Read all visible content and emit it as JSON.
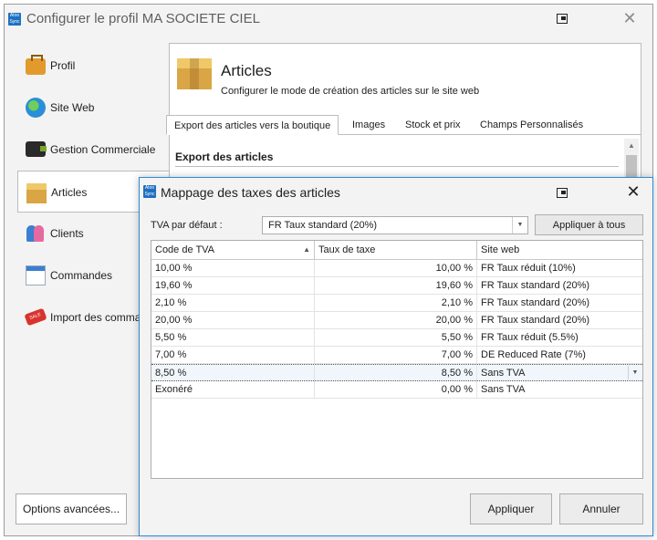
{
  "main_window": {
    "title": "Configurer le profil MA SOCIETE CIEL",
    "app_icon_text": "Atoo Sync"
  },
  "sidebar": {
    "items": [
      {
        "label": "Profil",
        "icon": "briefcase-icon"
      },
      {
        "label": "Site Web",
        "icon": "globe-icon"
      },
      {
        "label": "Gestion Commerciale",
        "icon": "wallet-icon"
      },
      {
        "label": "Articles",
        "icon": "box-icon",
        "active": true
      },
      {
        "label": "Clients",
        "icon": "users-icon"
      },
      {
        "label": "Commandes",
        "icon": "calendar-icon"
      },
      {
        "label": "Import des commandes",
        "icon": "sale-tag-icon"
      }
    ],
    "options_label": "Options avancées..."
  },
  "panel": {
    "title": "Articles",
    "subtitle": "Configurer le mode de création des articles sur le site web",
    "tabs": [
      {
        "label": "Export des articles vers la boutique",
        "active": true
      },
      {
        "label": "Images"
      },
      {
        "label": "Stock et prix"
      },
      {
        "label": "Champs Personnalisés"
      }
    ],
    "section_title": "Export des articles"
  },
  "dialog": {
    "title": "Mappage des taxes des articles",
    "app_icon_text": "Atoo Sync",
    "default_tva_label": "TVA par défaut :",
    "default_tva_value": "FR Taux standard (20%)",
    "apply_all_label": "Appliquer à tous",
    "columns": [
      "Code de TVA",
      "Taux de taxe",
      "Site web"
    ],
    "rows": [
      {
        "code": "10,00 %",
        "rate": "10,00 %",
        "site": "FR Taux réduit (10%)"
      },
      {
        "code": "19,60 %",
        "rate": "19,60 %",
        "site": "FR Taux standard (20%)"
      },
      {
        "code": "2,10 %",
        "rate": "2,10 %",
        "site": "FR Taux standard (20%)"
      },
      {
        "code": "20,00 %",
        "rate": "20,00 %",
        "site": "FR Taux standard (20%)"
      },
      {
        "code": "5,50 %",
        "rate": "5,50 %",
        "site": "FR Taux réduit (5.5%)"
      },
      {
        "code": "7,00 %",
        "rate": "7,00 %",
        "site": "DE Reduced Rate (7%)"
      },
      {
        "code": "8,50 %",
        "rate": "8,50 %",
        "site": "Sans TVA",
        "selected": true
      },
      {
        "code": "Exonéré",
        "rate": "0,00 %",
        "site": "Sans TVA"
      }
    ],
    "apply_label": "Appliquer",
    "cancel_label": "Annuler"
  },
  "colors": {
    "dialog_border": "#2b8ad6",
    "window_bg": "#f3f3f3",
    "selected_row_bg": "#f1f6fc"
  }
}
